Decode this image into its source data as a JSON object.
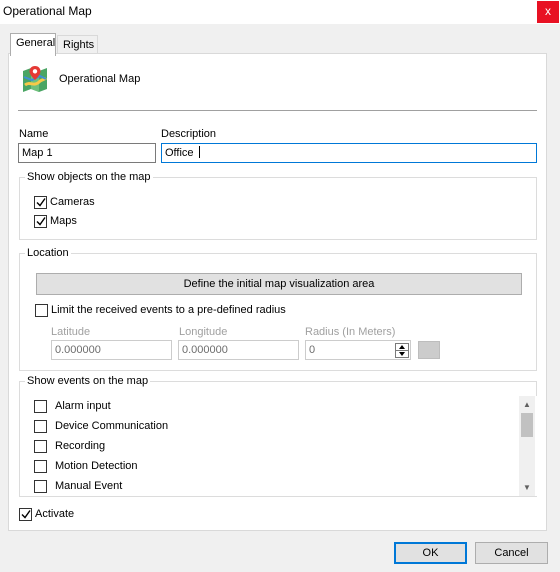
{
  "window": {
    "title": "Operational Map",
    "close_glyph": "x"
  },
  "tabs": [
    {
      "label": "General",
      "active": true
    },
    {
      "label": "Rights",
      "active": false
    }
  ],
  "header": {
    "icon": "map-icon",
    "name": "Operational Map"
  },
  "fields": {
    "name_label": "Name",
    "name_value": "Map 1",
    "description_label": "Description",
    "description_value": "Office "
  },
  "show_objects": {
    "title": "Show objects on the map",
    "items": [
      {
        "label": "Cameras",
        "checked": true
      },
      {
        "label": "Maps",
        "checked": true
      }
    ]
  },
  "location": {
    "title": "Location",
    "define_button": "Define the initial map visualization area",
    "limit_label": "Limit the received events to a pre-defined radius",
    "limit_checked": false,
    "latitude_label": "Latitude",
    "latitude_value": "0.000000",
    "longitude_label": "Longitude",
    "longitude_value": "0.000000",
    "radius_label": "Radius (In Meters)",
    "radius_value": "0"
  },
  "show_events": {
    "title": "Show events on the map",
    "items": [
      {
        "label": "Alarm input",
        "checked": false
      },
      {
        "label": "Device Communication",
        "checked": false
      },
      {
        "label": "Recording",
        "checked": false
      },
      {
        "label": "Motion Detection",
        "checked": false
      },
      {
        "label": "Manual Event",
        "checked": false
      }
    ]
  },
  "activate": {
    "label": "Activate",
    "checked": true
  },
  "buttons": {
    "ok": "OK",
    "cancel": "Cancel"
  },
  "colors": {
    "accent": "#0078d7",
    "close": "#e81123"
  }
}
